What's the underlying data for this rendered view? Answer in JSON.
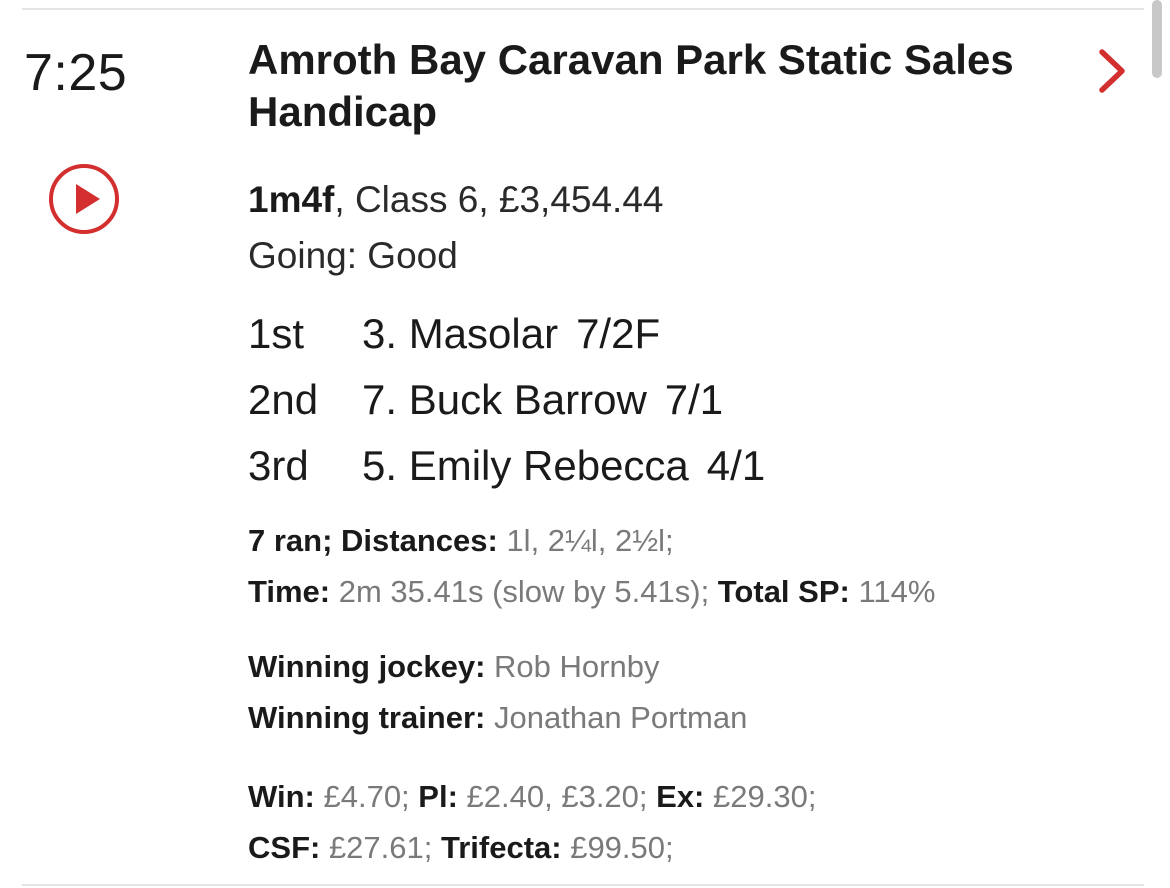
{
  "race": {
    "time": "7:25",
    "title": "Amroth Bay Caravan Park Static Sales Handicap",
    "distance": "1m4f",
    "class_prize": ", Class 6, £3,454.44",
    "going": "Going: Good"
  },
  "placings": [
    {
      "pos": "1st",
      "horse": "3. Masolar",
      "odds": "7/2F"
    },
    {
      "pos": "2nd",
      "horse": "7. Buck Barrow",
      "odds": "7/1"
    },
    {
      "pos": "3rd",
      "horse": "5. Emily Rebecca",
      "odds": "4/1"
    }
  ],
  "result": {
    "ran_label": "7 ran; Distances: ",
    "distances": "1l, 2¼l, 2½l;",
    "time_label": "Time: ",
    "time_value": "2m 35.41s (slow by 5.41s);",
    "sp_label": " Total SP: ",
    "sp_value": "114%"
  },
  "connections": {
    "jockey_label": "Winning jockey: ",
    "jockey": "Rob Hornby",
    "trainer_label": "Winning trainer: ",
    "trainer": "Jonathan Portman"
  },
  "dividends": {
    "win_label": "Win: ",
    "win": "£4.70;",
    "pl_label": " Pl: ",
    "pl": "£2.40, £3.20;",
    "ex_label": " Ex: ",
    "ex": "£29.30;",
    "csf_label": "CSF: ",
    "csf": "£27.61;",
    "tri_label": " Trifecta: ",
    "tri": "£99.50;"
  },
  "icons": {
    "play": "play-circle-icon",
    "chevron": "chevron-right-icon"
  },
  "colors": {
    "accent": "#d32f2f",
    "muted_text": "#7a7a7a"
  }
}
